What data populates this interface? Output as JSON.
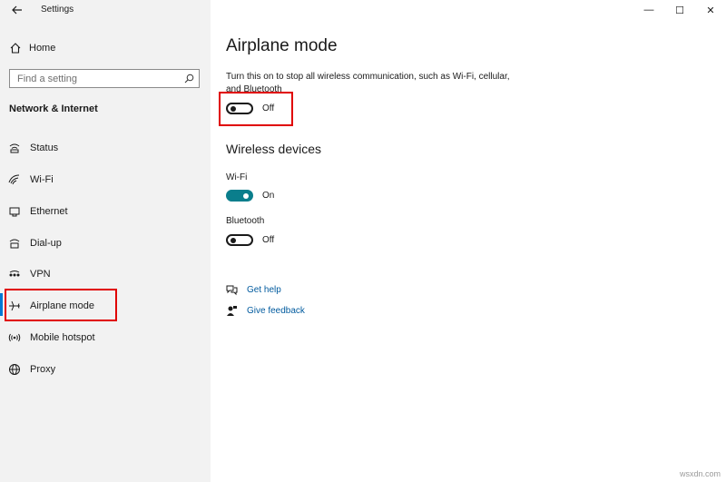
{
  "window": {
    "title": "Settings",
    "minimize": "—",
    "maximize": "☐",
    "close": "✕"
  },
  "sidebar": {
    "home_label": "Home",
    "search_placeholder": "Find a setting",
    "section_title": "Network & Internet",
    "items": [
      {
        "label": "Status",
        "icon": "status-icon"
      },
      {
        "label": "Wi-Fi",
        "icon": "wifi-icon"
      },
      {
        "label": "Ethernet",
        "icon": "ethernet-icon"
      },
      {
        "label": "Dial-up",
        "icon": "dialup-icon"
      },
      {
        "label": "VPN",
        "icon": "vpn-icon"
      },
      {
        "label": "Airplane mode",
        "icon": "airplane-icon",
        "selected": true
      },
      {
        "label": "Mobile hotspot",
        "icon": "hotspot-icon"
      },
      {
        "label": "Proxy",
        "icon": "globe-icon"
      }
    ]
  },
  "main": {
    "title": "Airplane mode",
    "description": "Turn this on to stop all wireless communication, such as Wi-Fi, cellular, and Bluetooth",
    "airplane_toggle": {
      "state": "Off",
      "on": false
    },
    "wireless_heading": "Wireless devices",
    "wifi": {
      "label": "Wi-Fi",
      "state": "On",
      "on": true
    },
    "bluetooth": {
      "label": "Bluetooth",
      "state": "Off",
      "on": false
    },
    "links": {
      "help": "Get help",
      "feedback": "Give feedback"
    }
  },
  "watermark": "wsxdn.com",
  "colors": {
    "accent": "#0078d4",
    "toggle_on": "#0a7e8c",
    "highlight": "#e00000",
    "link": "#005a9e"
  }
}
